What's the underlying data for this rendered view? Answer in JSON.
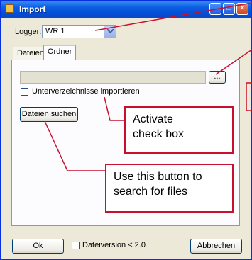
{
  "window": {
    "title": "Import",
    "controls": [
      "min",
      "max",
      "close"
    ]
  },
  "logger": {
    "label": "Logger:",
    "value": "WR 1"
  },
  "tabs": [
    {
      "label": "Dateien",
      "active": false
    },
    {
      "label": "Ordner",
      "active": true
    }
  ],
  "folder": {
    "browse_label": "...",
    "subdirs_label": "Unterverzeichnisse importieren",
    "search_button": "Dateien suchen"
  },
  "footer": {
    "ok_label": "Ok",
    "version_label": "Dateiversion < 2.0",
    "cancel_label": "Abbrechen"
  },
  "callouts": {
    "checkbox": "Activate check box",
    "search": "Use this button to search for files"
  },
  "colors": {
    "callout_border": "#c8102e",
    "titlebar": "#0a5ee0",
    "window_bg": "#ECE9D8"
  }
}
